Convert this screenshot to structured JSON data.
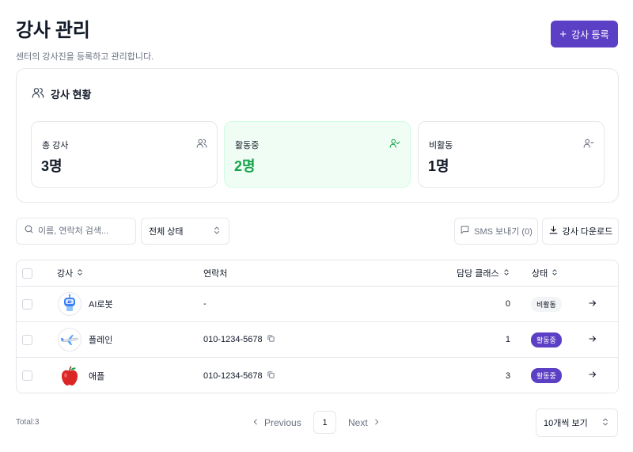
{
  "header": {
    "title": "강사 관리",
    "subtitle": "센터의 강사진을 등록하고 관리합니다.",
    "add_button": "강사 등록"
  },
  "stats": {
    "title": "강사 현황",
    "items": [
      {
        "label": "총 강사",
        "value": "3명"
      },
      {
        "label": "활동중",
        "value": "2명"
      },
      {
        "label": "비활동",
        "value": "1명"
      }
    ]
  },
  "toolbar": {
    "search_placeholder": "이름, 연락처 검색...",
    "status_select": "전체 상태",
    "sms_button": "SMS 보내기 (0)",
    "download_button": "강사 다운로드"
  },
  "table": {
    "columns": [
      "강사",
      "연락처",
      "담당 클래스",
      "상태"
    ],
    "rows": [
      {
        "name": "AI로봇",
        "contact": "-",
        "classes": "0",
        "status": "비활동"
      },
      {
        "name": "플레인",
        "contact": "010-1234-5678",
        "classes": "1",
        "status": "활동중"
      },
      {
        "name": "애플",
        "contact": "010-1234-5678",
        "classes": "3",
        "status": "활동중"
      }
    ]
  },
  "footer": {
    "total": "Total:3",
    "prev": "Previous",
    "page": "1",
    "next": "Next",
    "page_size": "10개씩 보기"
  },
  "colors": {
    "primary": "#5b3fc4",
    "active_text": "#16a34a",
    "active_bg": "#f0fdf4",
    "border": "#e5e7eb"
  }
}
